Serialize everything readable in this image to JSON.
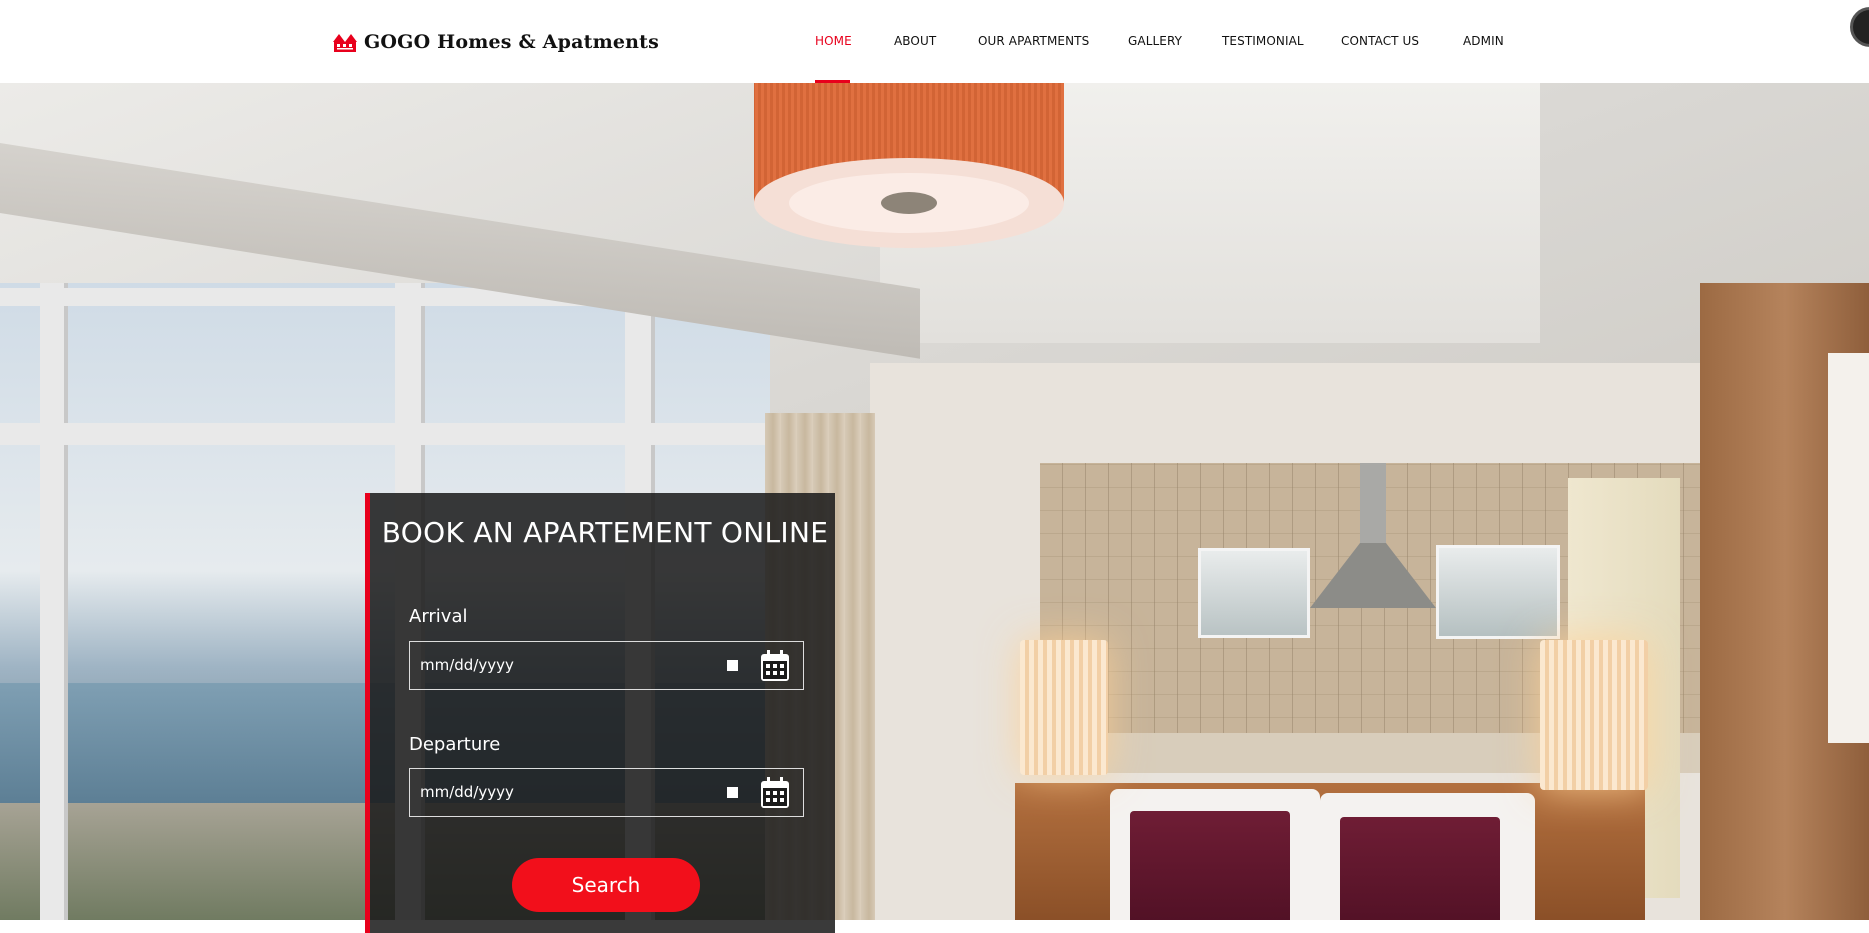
{
  "brand": {
    "name": "GOGO Homes & Apatments",
    "accent_color": "#e8001c",
    "logo_icon": "houses-logo-icon"
  },
  "nav": {
    "items": [
      {
        "label": "HOME",
        "active": true
      },
      {
        "label": "ABOUT",
        "active": false
      },
      {
        "label": "OUR APARTMENTS",
        "active": false
      },
      {
        "label": "GALLERY",
        "active": false
      },
      {
        "label": "TESTIMONIAL",
        "active": false
      },
      {
        "label": "CONTACT US",
        "active": false
      },
      {
        "label": "ADMIN",
        "active": false
      }
    ]
  },
  "hero": {
    "background": "apartment-interior-photo"
  },
  "booking": {
    "title": "BOOK AN APARTEMENT ONLINE",
    "arrival": {
      "label": "Arrival",
      "placeholder": "mm/dd/yyyy",
      "icon": "calendar-icon"
    },
    "departure": {
      "label": "Departure",
      "placeholder": "mm/dd/yyyy",
      "icon": "calendar-icon"
    },
    "search_label": "Search"
  }
}
